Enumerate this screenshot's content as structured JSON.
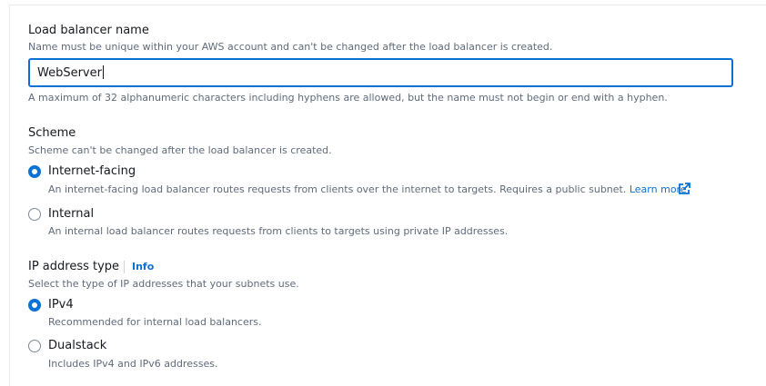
{
  "name_section": {
    "label": "Load balancer name",
    "description": "Name must be unique within your AWS account and can't be changed after the load balancer is created.",
    "value": "WebServer",
    "constraint": "A maximum of 32 alphanumeric characters including hyphens are allowed, but the name must not begin or end with a hyphen."
  },
  "scheme_section": {
    "label": "Scheme",
    "description": "Scheme can't be changed after the load balancer is created.",
    "options": [
      {
        "label": "Internet-facing",
        "description": "An internet-facing load balancer routes requests from clients over the internet to targets. Requires a public subnet.",
        "link": "Learn more",
        "selected": true
      },
      {
        "label": "Internal",
        "description": "An internal load balancer routes requests from clients to targets using private IP addresses.",
        "selected": false
      }
    ]
  },
  "ip_section": {
    "label": "IP address type",
    "info": "Info",
    "description": "Select the type of IP addresses that your subnets use.",
    "options": [
      {
        "label": "IPv4",
        "description": "Recommended for internal load balancers.",
        "selected": true
      },
      {
        "label": "Dualstack",
        "description": "Includes IPv4 and IPv6 addresses.",
        "selected": false
      }
    ]
  },
  "colors": {
    "accent": "#0972d3",
    "text": "#16191f",
    "secondary_text": "#5f6b7a"
  },
  "icons": {
    "external_link": "external-link-icon"
  }
}
